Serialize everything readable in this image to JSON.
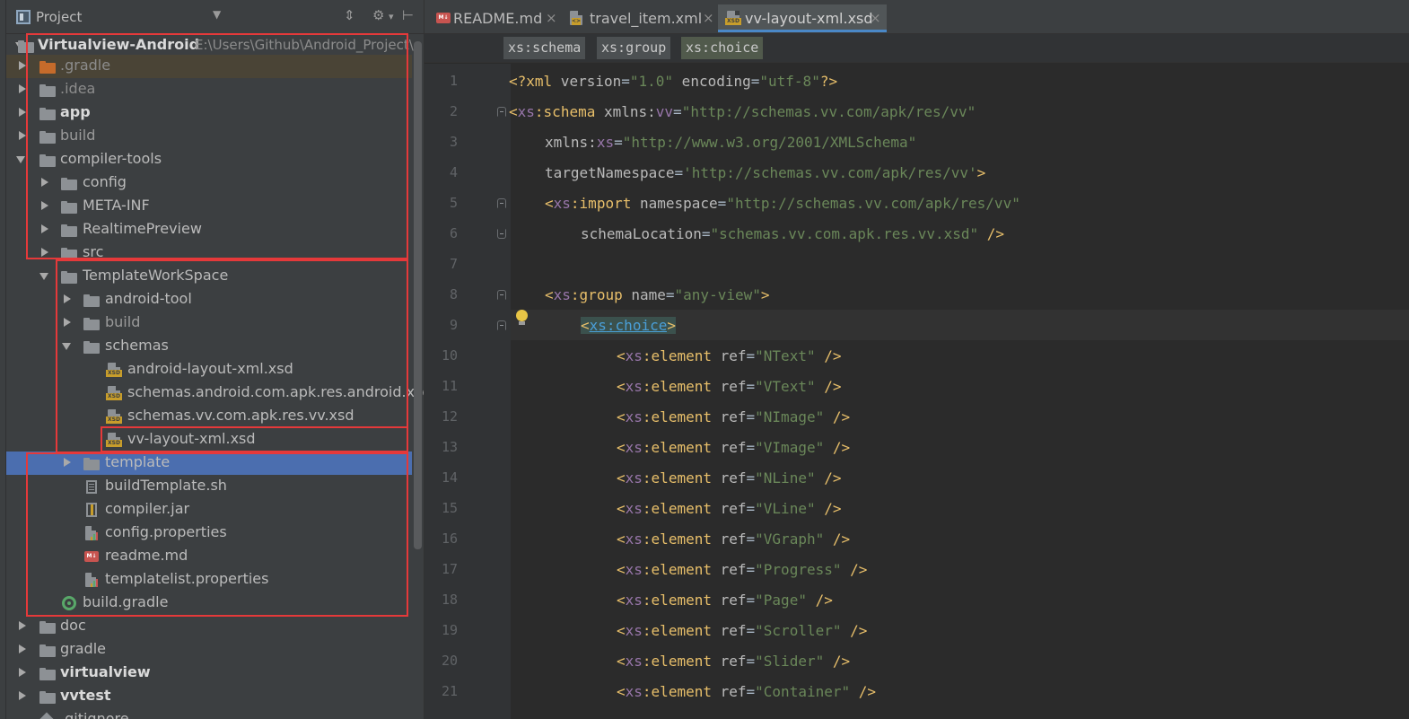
{
  "project_panel": {
    "title": "Project",
    "dropdown_icon": "chevron-down-icon",
    "header_icons": [
      "collapse-icon",
      "gear-icon",
      "hide-icon"
    ],
    "root": {
      "name": "Virtualview-Android",
      "path": "E:\\Users\\Github\\Android_Project\\"
    },
    "tree": [
      {
        "label": ".gradle"
      },
      {
        "label": ".idea"
      },
      {
        "label": "app"
      },
      {
        "label": "build"
      },
      {
        "label": "compiler-tools"
      },
      {
        "label": "config"
      },
      {
        "label": "META-INF"
      },
      {
        "label": "RealtimePreview"
      },
      {
        "label": "src"
      },
      {
        "label": "TemplateWorkSpace"
      },
      {
        "label": "android-tool"
      },
      {
        "label": "build"
      },
      {
        "label": "schemas"
      },
      {
        "label": "android-layout-xml.xsd"
      },
      {
        "label": "schemas.android.com.apk.res.android.xsd"
      },
      {
        "label": "schemas.vv.com.apk.res.vv.xsd"
      },
      {
        "label": "vv-layout-xml.xsd"
      },
      {
        "label": "template"
      },
      {
        "label": "buildTemplate.sh"
      },
      {
        "label": "compiler.jar"
      },
      {
        "label": "config.properties"
      },
      {
        "label": "readme.md"
      },
      {
        "label": "templatelist.properties"
      },
      {
        "label": "build.gradle"
      },
      {
        "label": "doc"
      },
      {
        "label": "gradle"
      },
      {
        "label": "virtualview"
      },
      {
        "label": "vvtest"
      },
      {
        "label": ".gitignore"
      }
    ],
    "badges": {
      "md": "M↓",
      "xsd": "XSD"
    }
  },
  "editor": {
    "tabs": [
      {
        "label": "README.md"
      },
      {
        "label": "travel_item.xml"
      },
      {
        "label": "vv-layout-xml.xsd"
      }
    ],
    "close_glyph": "×",
    "breadcrumbs": [
      "xs:schema",
      "xs:group",
      "xs:choice"
    ],
    "line_numbers": [
      "1",
      "2",
      "3",
      "4",
      "5",
      "6",
      "7",
      "8",
      "9",
      "10",
      "11",
      "12",
      "13",
      "14",
      "15",
      "16",
      "17",
      "18",
      "19",
      "20",
      "21"
    ],
    "code": {
      "l1": {
        "open": "<?",
        "kw": "xml",
        "a1": " version",
        "eq1": "=",
        "v1": "\"1.0\"",
        "a2": " encoding",
        "eq2": "=",
        "v2": "\"utf-8\"",
        "close": "?>"
      },
      "l2": {
        "open": "<",
        "ns": "xs",
        "colon": ":",
        "tag": "schema",
        "a1": " xmlns",
        "a1c": ":",
        "a1ns": "vv",
        "eq": "=",
        "v": "\"http://schemas.vv.com/apk/res/vv\""
      },
      "l3": {
        "a": "xmlns",
        "c": ":",
        "ns": "xs",
        "eq": "=",
        "v": "\"http://www.w3.org/2001/XMLSchema\""
      },
      "l4": {
        "a": "targetNamespace",
        "eq": "=",
        "v": "'http://schemas.vv.com/apk/res/vv'",
        "close": ">"
      },
      "l5": {
        "open": "<",
        "ns": "xs",
        "colon": ":",
        "tag": "import",
        "a": " namespace",
        "eq": "=",
        "v": "\"http://schemas.vv.com/apk/res/vv\""
      },
      "l6": {
        "a": "schemaLocation",
        "eq": "=",
        "v": "\"schemas.vv.com.apk.res.vv.xsd\"",
        "close": " />"
      },
      "l8": {
        "open": "<",
        "ns": "xs",
        "colon": ":",
        "tag": "group",
        "a": " name",
        "eq": "=",
        "v": "\"any-view\"",
        "close": ">"
      },
      "l9": {
        "open": "<",
        "ns": "xs",
        "colon": ":",
        "tag": "choice",
        "close": ">"
      },
      "elements": [
        "\"NText\"",
        "\"VText\"",
        "\"NImage\"",
        "\"VImage\"",
        "\"NLine\"",
        "\"VLine\"",
        "\"VGraph\"",
        "\"Progress\"",
        "\"Page\"",
        "\"Scroller\"",
        "\"Slider\"",
        "\"Container\""
      ],
      "el": {
        "open": "<",
        "ns": "xs",
        "colon": ":",
        "tag": "element",
        "a": " ref",
        "eq": "=",
        "close": " />"
      }
    },
    "bulb_icon": "lightbulb-icon"
  },
  "colors": {
    "accent": "#4b6eaf",
    "highlight_box": "#e5393a"
  }
}
